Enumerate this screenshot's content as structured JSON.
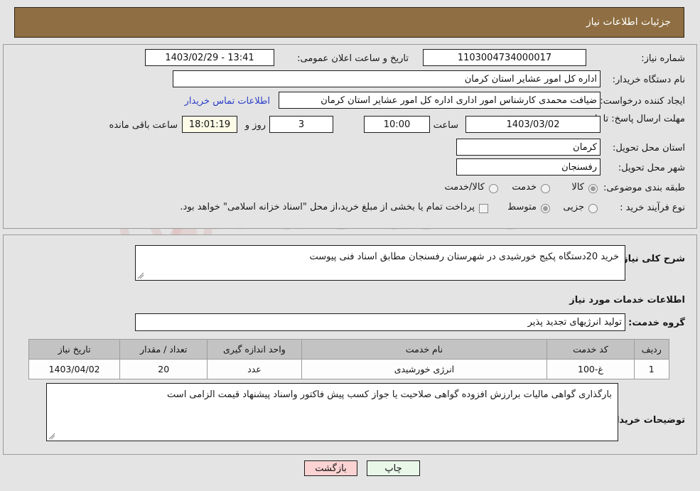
{
  "header": {
    "title": "جزئیات اطلاعات نیاز"
  },
  "watermark": {
    "text": "AriaTender.net",
    "shield_icon": "shield-icon",
    "arrow_icon": "down-arrow-icon"
  },
  "basic": {
    "need_number_label": "شماره نیاز:",
    "need_number_value": "1103004734000017",
    "announce_datetime_label": "تاریخ و ساعت اعلان عمومی:",
    "announce_datetime_value": "13:41 - 1403/02/29",
    "buyer_org_label": "نام دستگاه خریدار:",
    "buyer_org_value": "اداره کل امور عشایر استان کرمان",
    "creator_label": "ایجاد کننده درخواست:",
    "creator_value": "ضیافت محمدی کارشناس امور اداری اداره کل امور عشایر استان کرمان",
    "contact_link": "اطلاعات تماس خریدار",
    "deadline_label": "مهلت ارسال پاسخ: تا تاریخ:",
    "deadline_date": "1403/03/02",
    "deadline_hour_label": "ساعت",
    "deadline_hour_value": "10:00",
    "remaining_days_value": "3",
    "remaining_days_suffix": "روز و",
    "remaining_time_value": "18:01:19",
    "remaining_time_suffix": "ساعت باقی مانده",
    "province_label": "استان محل تحویل:",
    "province_value": "کرمان",
    "city_label": "شهر محل تحویل:",
    "city_value": "رفسنجان",
    "category_label": "طبقه بندی موضوعی:",
    "category_options": [
      {
        "label": "کالا",
        "checked": true
      },
      {
        "label": "خدمت",
        "checked": false
      },
      {
        "label": "کالا/خدمت",
        "checked": false
      }
    ],
    "process_label": "نوع فرآیند خرید :",
    "process_options": [
      {
        "label": "جزیی",
        "checked": false
      },
      {
        "label": "متوسط",
        "checked": true
      }
    ],
    "payment_checkbox_label": "پرداخت تمام یا بخشی از مبلغ خرید،از محل \"اسناد خزانه اسلامی\" خواهد بود.",
    "payment_checkbox_checked": false
  },
  "detail": {
    "summary_label": "شرح کلی نیاز:",
    "summary_value": "خرید 20دستگاه پکیج خورشیدی در شهرستان رفسنجان مطابق اسناد فنی پیوست",
    "services_section_title": "اطلاعات خدمات مورد نیاز",
    "service_group_label": "گروه خدمت:",
    "service_group_value": "تولید انرژیهای تجدید پذیر",
    "table": {
      "columns": [
        "ردیف",
        "کد خدمت",
        "نام خدمت",
        "واحد اندازه گیری",
        "تعداد / مقدار",
        "تاریخ نیاز"
      ],
      "rows": [
        [
          "1",
          "غ-100",
          "انرژی خورشیدی",
          "عدد",
          "20",
          "1403/04/02"
        ]
      ]
    },
    "buyer_notes_label": "توضیحات خریدار:",
    "buyer_notes_value": "بارگذاری گواهی مالیات برارزش افزوده گواهی صلاحیت یا جواز کسب پیش فاکتور واسناد پیشنهاد قیمت الزامی است"
  },
  "footer": {
    "print_label": "چاپ",
    "back_label": "بازگشت"
  },
  "colors": {
    "header_bar": "#8e6e42",
    "page_background": "#e4e4e4",
    "link": "#2b3ec9",
    "timer_background": "#fbfbe8",
    "table_header": "#c3c3c3",
    "print_button": "#e9f7e9",
    "back_button": "#fbd3d3"
  }
}
